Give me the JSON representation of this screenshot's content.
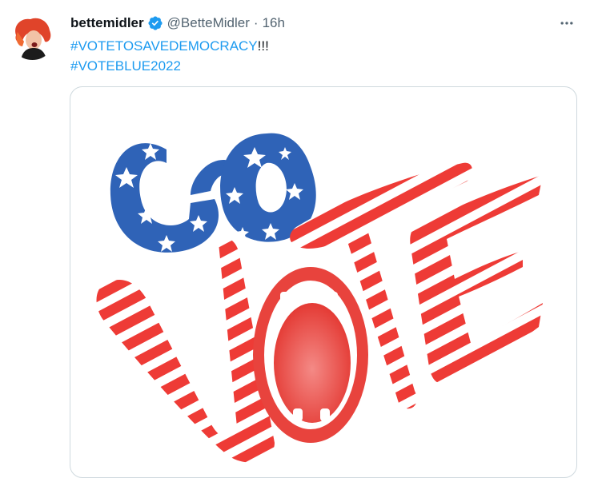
{
  "tweet": {
    "author_name": "bettemidler",
    "handle": "@BetteMidler",
    "separator": "·",
    "time": "16h",
    "verified": true,
    "text_parts": {
      "hashtag1": "#VOTETOSAVEDEMOCRACY",
      "suffix1": "!!!",
      "hashtag2": "#VOTEBLUE2022"
    }
  },
  "media": {
    "artwork_text": "GO VOTE"
  },
  "icons": {
    "avatar": "avatar-photo",
    "verified": "verified-badge-icon",
    "more": "more-options-icon"
  },
  "colors": {
    "accent": "#1d9bf0",
    "secondary_text": "#536471",
    "border": "#cfd9de",
    "art_blue": "#2f63b7",
    "art_red": "#ee3b36"
  }
}
